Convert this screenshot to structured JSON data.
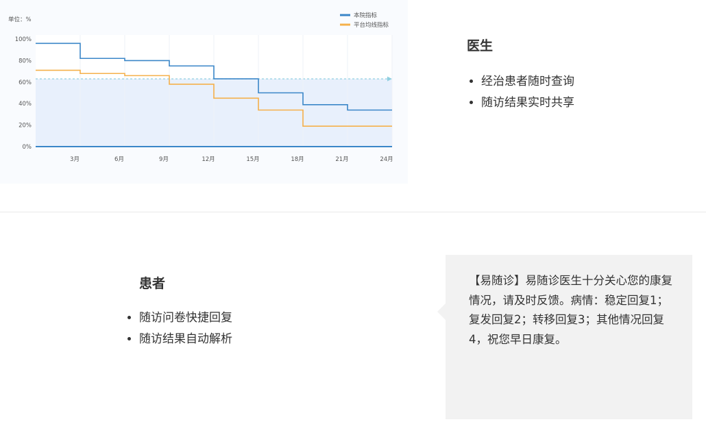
{
  "chart_data": {
    "type": "line",
    "step": true,
    "unit_label": "单位：%",
    "x_ticks": [
      "3月",
      "6月",
      "9月",
      "12月",
      "15月",
      "18月",
      "21月",
      "24月"
    ],
    "y_ticks": [
      "100%",
      "80%",
      "60%",
      "40%",
      "20%",
      "0%"
    ],
    "xlim": [
      0,
      24
    ],
    "ylim": [
      0,
      100
    ],
    "reference_line": 63,
    "legend_position": "top-right",
    "series": [
      {
        "name": "本院指标",
        "color": "#3a86c8",
        "steps": [
          [
            0,
            96
          ],
          [
            3,
            82
          ],
          [
            6,
            80
          ],
          [
            9,
            75
          ],
          [
            12,
            63
          ],
          [
            15,
            50
          ],
          [
            18,
            39
          ],
          [
            21,
            34
          ],
          [
            24,
            34
          ]
        ]
      },
      {
        "name": "平台均线指标",
        "color": "#f5b04a",
        "steps": [
          [
            0,
            71
          ],
          [
            3,
            68
          ],
          [
            6,
            66
          ],
          [
            9,
            58
          ],
          [
            12,
            45
          ],
          [
            15,
            34
          ],
          [
            18,
            19
          ],
          [
            21,
            19
          ],
          [
            24,
            19
          ]
        ]
      }
    ]
  },
  "doctor": {
    "title": "医生",
    "items": [
      "经治患者随时查询",
      "随访结果实时共享"
    ]
  },
  "patient": {
    "title": "患者",
    "items": [
      "随访问卷快捷回复",
      "随访结果自动解析"
    ]
  },
  "sms": {
    "text": "【易随诊】易随诊医生十分关心您的康复情况，请及时反馈。病情：稳定回复1；复发回复2；转移回复3；其他情况回复4，祝您早日康复。"
  }
}
